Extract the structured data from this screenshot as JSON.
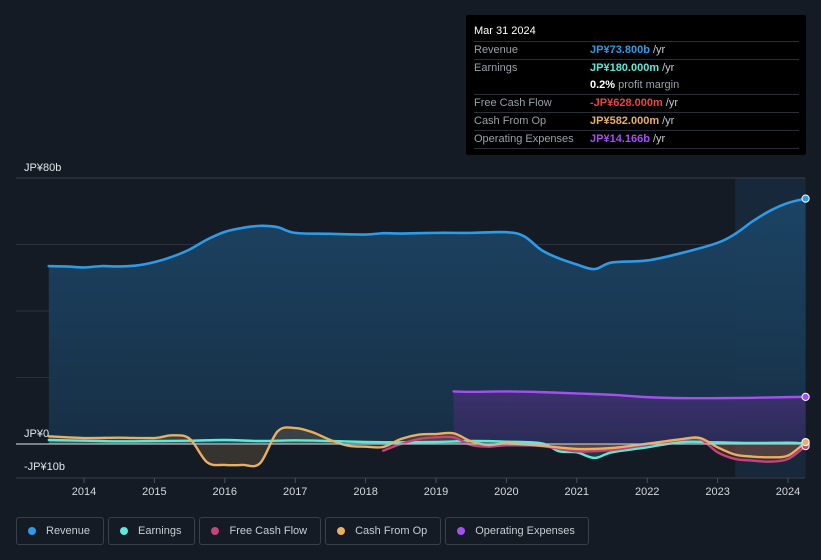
{
  "tooltip": {
    "date": "Mar 31 2024",
    "rows": [
      {
        "label": "Revenue",
        "value": "JP¥73.800b",
        "unit": "/yr",
        "color": "#2d9be6"
      },
      {
        "label": "Earnings",
        "value": "JP¥180.000m",
        "unit": "/yr",
        "color": "#5ee8d6"
      },
      {
        "label": "",
        "value": "0.2%",
        "unit": "profit margin",
        "color": "#ffffff"
      },
      {
        "label": "Free Cash Flow",
        "value": "-JP¥628.000m",
        "unit": "/yr",
        "color": "#e84545"
      },
      {
        "label": "Cash From Op",
        "value": "JP¥582.000m",
        "unit": "/yr",
        "color": "#e9b060"
      },
      {
        "label": "Operating Expenses",
        "value": "JP¥14.166b",
        "unit": "/yr",
        "color": "#a64ff0"
      }
    ]
  },
  "legend": [
    {
      "label": "Revenue",
      "color": "#2d9be6"
    },
    {
      "label": "Earnings",
      "color": "#5ee8d6"
    },
    {
      "label": "Free Cash Flow",
      "color": "#c4437a"
    },
    {
      "label": "Cash From Op",
      "color": "#e9b060"
    },
    {
      "label": "Operating Expenses",
      "color": "#a64ff0"
    }
  ],
  "chart_data": {
    "type": "area",
    "title": "",
    "xlabel": "",
    "ylabel": "",
    "x_ticks": [
      "2014",
      "2015",
      "2016",
      "2017",
      "2018",
      "2019",
      "2020",
      "2021",
      "2022",
      "2023",
      "2024"
    ],
    "y_tick_labels": [
      {
        "value": 80,
        "label": "JP¥80b"
      },
      {
        "value": 0,
        "label": "JP¥0"
      },
      {
        "value": -10,
        "label": "-JP¥10b"
      }
    ],
    "ylim": [
      -10,
      80
    ],
    "xlim": [
      2013.0,
      2024.3
    ],
    "grid": true,
    "highlight_range": [
      2023.25,
      2024.25
    ],
    "units": "JP¥ billions",
    "series": [
      {
        "name": "Revenue",
        "color": "#2d9be6",
        "x": [
          2013.5,
          2013.75,
          2014.0,
          2014.25,
          2014.5,
          2014.75,
          2015.0,
          2015.25,
          2015.5,
          2015.75,
          2016.0,
          2016.25,
          2016.5,
          2016.75,
          2017.0,
          2017.5,
          2018.0,
          2018.25,
          2018.5,
          2019.0,
          2019.5,
          2020.0,
          2020.25,
          2020.5,
          2020.75,
          2021.0,
          2021.25,
          2021.5,
          2022.0,
          2022.5,
          2023.0,
          2023.25,
          2023.5,
          2023.75,
          2024.0,
          2024.25
        ],
        "values": [
          53.5,
          53.4,
          53.1,
          53.5,
          53.4,
          53.7,
          54.7,
          56.3,
          58.5,
          61.5,
          63.8,
          65.0,
          65.6,
          65.2,
          63.5,
          63.2,
          63.0,
          63.4,
          63.3,
          63.5,
          63.5,
          63.7,
          62.5,
          58.3,
          55.8,
          54.0,
          52.6,
          54.6,
          55.2,
          57.5,
          60.5,
          63.2,
          67.0,
          70.2,
          72.5,
          73.8
        ]
      },
      {
        "name": "Earnings",
        "color": "#5ee8d6",
        "x": [
          2013.5,
          2014.0,
          2014.5,
          2015.0,
          2015.5,
          2016.0,
          2016.5,
          2017.0,
          2017.5,
          2018.0,
          2018.5,
          2019.0,
          2019.5,
          2020.0,
          2020.5,
          2020.75,
          2021.0,
          2021.25,
          2021.5,
          2022.0,
          2022.5,
          2023.0,
          2023.5,
          2024.0,
          2024.25
        ],
        "values": [
          1.2,
          1.0,
          0.8,
          0.9,
          1.0,
          1.2,
          0.9,
          1.1,
          0.9,
          0.6,
          0.5,
          0.6,
          0.9,
          0.7,
          0.2,
          -2.2,
          -2.5,
          -4.2,
          -2.5,
          -1.0,
          0.6,
          0.5,
          0.3,
          0.4,
          0.18
        ]
      },
      {
        "name": "Free Cash Flow",
        "color": "#c4437a",
        "x": [
          2018.25,
          2018.5,
          2018.75,
          2019.0,
          2019.25,
          2019.5,
          2019.75,
          2020.0,
          2020.5,
          2021.0,
          2021.5,
          2022.0,
          2022.5,
          2022.75,
          2023.0,
          2023.25,
          2023.5,
          2023.75,
          2024.0,
          2024.25
        ],
        "values": [
          -2.0,
          0.0,
          1.5,
          2.0,
          2.0,
          -0.3,
          -0.8,
          -0.4,
          -0.6,
          -2.2,
          -1.8,
          -0.2,
          1.3,
          1.5,
          -2.5,
          -4.5,
          -5.0,
          -5.3,
          -4.5,
          -0.63
        ]
      },
      {
        "name": "Cash From Op",
        "color": "#e9b060",
        "x": [
          2013.5,
          2014.0,
          2014.5,
          2015.0,
          2015.25,
          2015.5,
          2015.75,
          2016.0,
          2016.25,
          2016.5,
          2016.75,
          2017.0,
          2017.25,
          2017.5,
          2017.75,
          2018.0,
          2018.25,
          2018.5,
          2018.75,
          2019.0,
          2019.25,
          2019.5,
          2019.75,
          2020.0,
          2020.5,
          2021.0,
          2021.5,
          2022.0,
          2022.5,
          2022.75,
          2023.0,
          2023.25,
          2023.5,
          2023.75,
          2024.0,
          2024.25
        ],
        "values": [
          2.3,
          1.8,
          1.9,
          1.8,
          2.6,
          1.6,
          -5.5,
          -6.3,
          -6.3,
          -5.8,
          3.8,
          4.8,
          3.5,
          1.2,
          -0.5,
          -0.8,
          -0.9,
          1.5,
          2.8,
          3.0,
          3.2,
          0.8,
          -0.3,
          0.2,
          -0.5,
          -1.5,
          -1.2,
          0.1,
          1.5,
          1.8,
          -1.0,
          -3.2,
          -3.8,
          -4.0,
          -3.5,
          0.58
        ]
      },
      {
        "name": "Operating Expenses",
        "color": "#a64ff0",
        "x": [
          2019.25,
          2019.5,
          2020.0,
          2020.5,
          2021.0,
          2021.5,
          2022.0,
          2022.5,
          2023.0,
          2023.5,
          2024.0,
          2024.25
        ],
        "values": [
          15.8,
          15.7,
          15.8,
          15.6,
          15.2,
          14.8,
          14.1,
          13.8,
          13.8,
          13.9,
          14.1,
          14.17
        ]
      }
    ]
  }
}
